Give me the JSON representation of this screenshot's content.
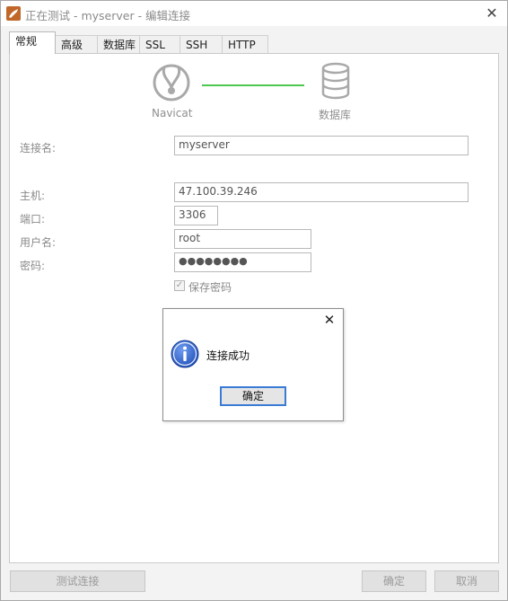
{
  "window": {
    "title": "正在测试 - myserver - 编辑连接",
    "close_glyph": "✕"
  },
  "tabs": [
    {
      "label": "常规",
      "active": true
    },
    {
      "label": "高级"
    },
    {
      "label": "数据库"
    },
    {
      "label": "SSL"
    },
    {
      "label": "SSH"
    },
    {
      "label": "HTTP"
    }
  ],
  "diagram": {
    "client_label": "Navicat",
    "server_label": "数据库",
    "line_color": "#4ec84e"
  },
  "form": {
    "conn_name_label": "连接名:",
    "conn_name_value": "myserver",
    "host_label": "主机:",
    "host_value": "47.100.39.246",
    "port_label": "端口:",
    "port_value": "3306",
    "user_label": "用户名:",
    "user_value": "root",
    "password_label": "密码:",
    "password_value": "●●●●●●●●",
    "save_password_label": "保存密码",
    "save_password_checked": true
  },
  "footer": {
    "test_button": "测试连接",
    "ok_button": "确定",
    "cancel_button": "取消"
  },
  "dialog": {
    "close_glyph": "✕",
    "message": "连接成功",
    "ok_button": "确定"
  },
  "colors": {
    "accent": "#3a7bd5",
    "info_blue": "#1f4fb8"
  }
}
